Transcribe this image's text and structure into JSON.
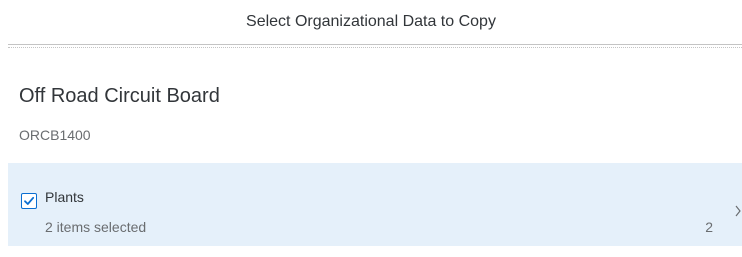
{
  "dialog": {
    "title": "Select Organizational Data to Copy"
  },
  "object": {
    "title": "Off Road Circuit Board",
    "id": "ORCB1400"
  },
  "list": {
    "items": [
      {
        "title": "Plants",
        "description": "2 items selected",
        "counter": "2",
        "checked": true,
        "icon": "chevron-right-icon"
      }
    ]
  },
  "colors": {
    "accent": "#0a6ed1",
    "selected_background": "#e5f0fa",
    "text_primary": "#32363a",
    "text_secondary": "#6a6d70"
  }
}
